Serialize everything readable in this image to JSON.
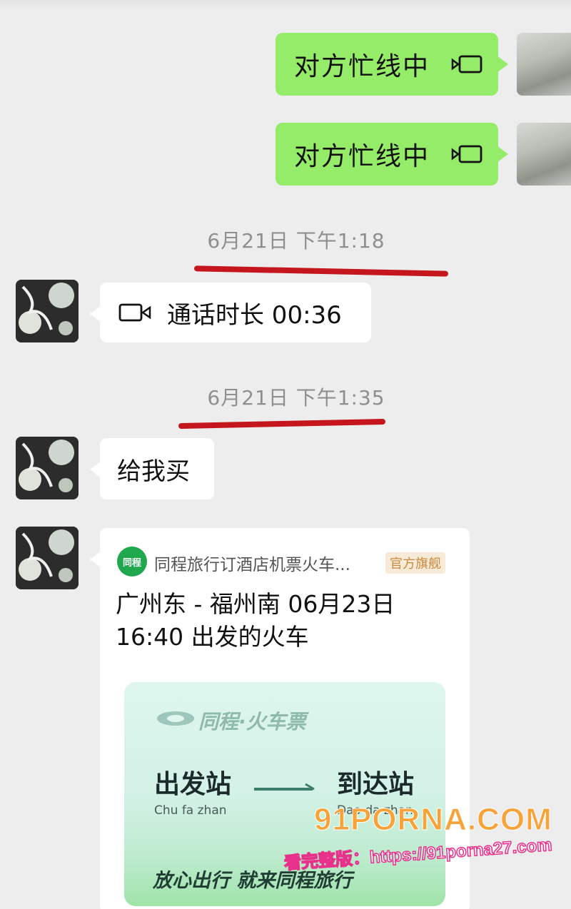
{
  "messages": {
    "sent_1": {
      "text": "对方忙线中"
    },
    "sent_2": {
      "text": "对方忙线中"
    },
    "time_1": "6月21日 下午1:18",
    "call": {
      "text": "通话时长 00:36"
    },
    "time_2": "6月21日 下午1:35",
    "text_msg": {
      "text": "给我买"
    }
  },
  "card": {
    "app_name": "同程旅行订酒店机票火车...",
    "app_logo_text": "同程",
    "badge": "官方旗舰",
    "title_line1": "广州东 - 福州南 06月23日",
    "title_line2": "16:40 出发的火车",
    "ticket": {
      "brand": "同程·火车票",
      "depart_label": "出发站",
      "depart_pinyin": "Chu fa zhan",
      "arrive_label": "到达站",
      "arrive_pinyin": "Dao da zhan",
      "slogan": "放心出行 就来同程旅行"
    }
  },
  "watermark": {
    "logo": "91PORNA.COM",
    "url": "看完整版：https://91porna27.com"
  },
  "colors": {
    "background": "#ededed",
    "sent_bubble": "#95ec69",
    "received_bubble": "#ffffff",
    "annotation_red": "#c4161c"
  },
  "icons": {
    "video_call": "video-camera-icon"
  }
}
